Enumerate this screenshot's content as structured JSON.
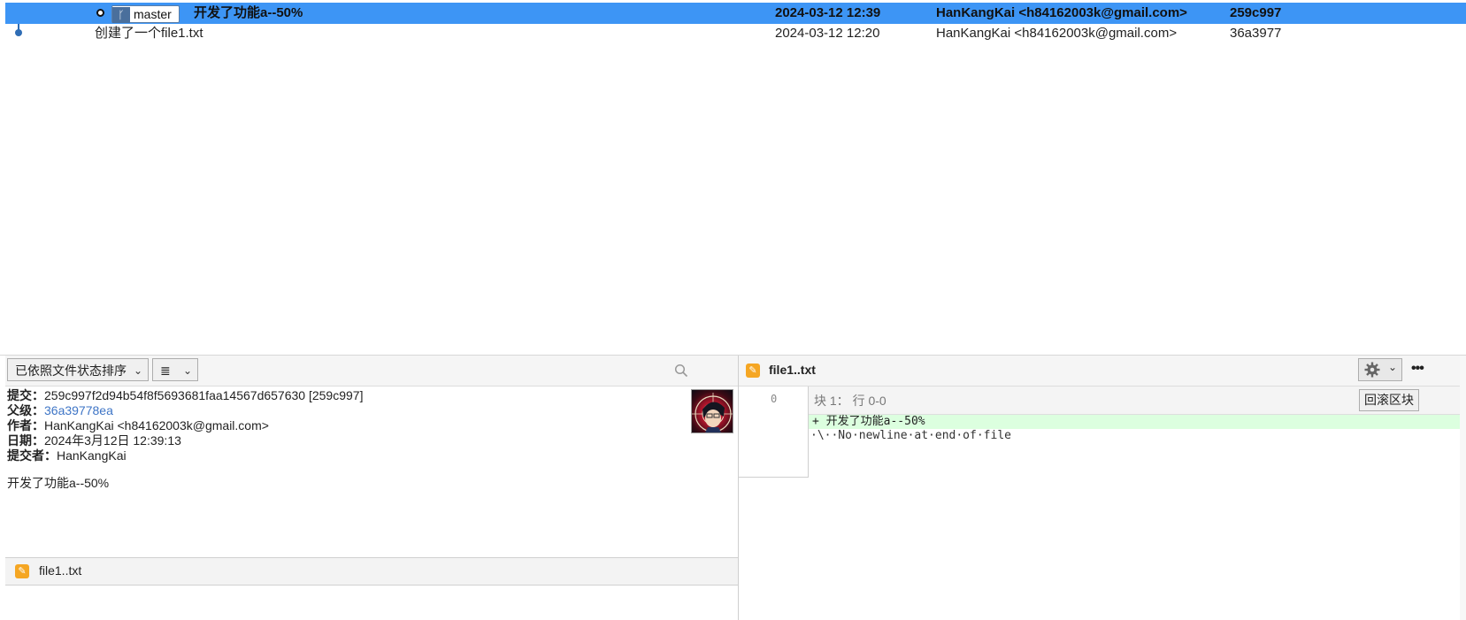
{
  "history": {
    "rows": [
      {
        "branch": "master",
        "message": "开发了功能a--50%",
        "date": "2024-03-12 12:39",
        "author": "HanKangKai <h84162003k@gmail.com>",
        "hash": "259c997",
        "selected": true
      },
      {
        "branch": "",
        "message": "创建了一个file1.txt",
        "date": "2024-03-12 12:20",
        "author": "HanKangKai <h84162003k@gmail.com>",
        "hash": "36a3977",
        "selected": false
      }
    ]
  },
  "left_pane": {
    "sort_dropdown": "已依照文件状态排序",
    "view_dropdown": "≣",
    "search_icon": "search-icon",
    "details": {
      "commit_label": "提交：",
      "commit_value": "259c997f2d94b54f8f5693681faa14567d657630 [259c997]",
      "parent_label": "父级：",
      "parent_value": "36a39778ea",
      "author_label": "作者：",
      "author_value": "HanKangKai <h84162003k@gmail.com>",
      "date_label": "日期：",
      "date_value": "2024年3月12日 12:39:13",
      "committer_label": "提交者：",
      "committer_value": "HanKangKai",
      "message": "开发了功能a--50%"
    },
    "files": [
      {
        "name": "file1..txt",
        "icon": "pencil-icon"
      }
    ]
  },
  "right_pane": {
    "file_title": "file1..txt",
    "hunk_header": "块 1： 行 0-0",
    "revert_hunk_button": "回滚区块",
    "more_icon": "•••",
    "diff": {
      "line_number": "0",
      "added_line": "+ 开发了功能a--50%",
      "note_line": "·\\··No·newline·at·end·of·file"
    }
  },
  "colors": {
    "selection": "#3d95f5",
    "added_bg": "#dcffdf",
    "link": "#3e75c6",
    "graph": "#2f6db5",
    "modified_icon": "#f5a623"
  }
}
